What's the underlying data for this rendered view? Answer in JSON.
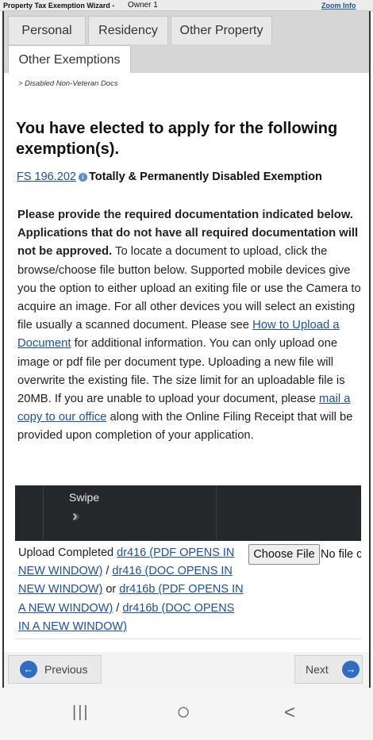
{
  "topbar": {
    "wizard_title": "Property Tax Exemption Wizard -",
    "owner": "Owner 1",
    "zoom_link": "Zoom Info"
  },
  "tabs": [
    {
      "label": "Personal"
    },
    {
      "label": "Residency"
    },
    {
      "label": "Other Property"
    },
    {
      "label": "Other Exemptions"
    }
  ],
  "breadcrumb": "> Disabled Non-Veteran Docs",
  "heading": "You have elected to apply for the following exemption(s).",
  "exemption": {
    "statute_link": "FS 196.202",
    "info_icon": "info-icon",
    "name": "Totally & Permanently Disabled Exemption"
  },
  "instructions": {
    "bold_text": "Please provide the required documentation indicated below. Applications that do not have all required documentation will not be approved.",
    "text_1": " To locate a document to upload, click the browse/choose file button below. Supported mobile devices give you the option to either upload an exiting file or use the Camera to acquire an image. For all other devices you will select an existing file usually a scanned document. Please see ",
    "link_1": "How to Upload a Document",
    "text_2": " for additional information. You can only upload one image or pdf file per document type. Uploading a new file will overwrite the existing file. The size limit for an uploadable file is 20MB. If you are unable to upload your document, please ",
    "link_2": "mail a copy to our office",
    "text_3": " along with the Online Filing Receipt that will be provided upon completion of your application."
  },
  "swipe": {
    "label": "Swipe",
    "arrows_icon": "chevron-right-icon"
  },
  "upload": {
    "prefix": "Upload Completed ",
    "link_1": "dr416 (PDF OPENS IN NEW WINDOW)",
    "sep_1": " / ",
    "link_2": "dr416 (DOC OPENS IN NEW WINDOW)",
    "sep_2": " or ",
    "link_3": "dr416b (PDF OPENS IN A NEW WINDOW)",
    "sep_3": " / ",
    "link_4": "dr416b (DOC OPENS IN A NEW WINDOW)",
    "choose_file_label": "Choose File",
    "no_file_text": "No file chosen"
  },
  "nav": {
    "previous_label": "Previous",
    "next_label": "Next"
  },
  "android_nav": {
    "recents_icon": "|||",
    "home_icon": "○",
    "back_icon": "<"
  },
  "colors": {
    "link": "#1c50a8",
    "swipe_bg": "#25282b",
    "nav_circle": "#2f6dc4"
  }
}
